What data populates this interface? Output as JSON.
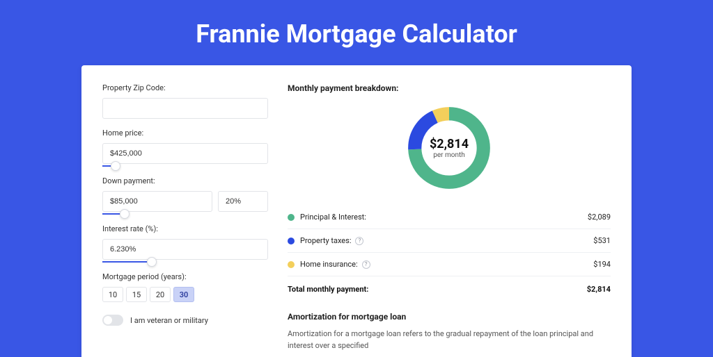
{
  "title": "Frannie Mortgage Calculator",
  "form": {
    "zip_label": "Property Zip Code:",
    "zip_value": "",
    "home_price_label": "Home price:",
    "home_price_value": "$425,000",
    "down_payment_label": "Down payment:",
    "down_payment_value": "$85,000",
    "down_payment_pct_value": "20%",
    "interest_label": "Interest rate (%):",
    "interest_value": "6.230%",
    "period_label": "Mortgage period (years):",
    "period_options": [
      "10",
      "15",
      "20",
      "30"
    ],
    "period_selected": "30",
    "veteran_label": "I am veteran or military"
  },
  "sliders": {
    "home_price_pct": 8,
    "down_payment_pct": 20,
    "interest_pct": 30
  },
  "breakdown": {
    "heading": "Monthly payment breakdown:",
    "donut_amount": "$2,814",
    "donut_sub": "per month",
    "items": [
      {
        "label": "Principal & Interest:",
        "value": "$2,089",
        "color": "#4fb58b",
        "info": false
      },
      {
        "label": "Property taxes:",
        "value": "$531",
        "color": "#2b4ae0",
        "info": true
      },
      {
        "label": "Home insurance:",
        "value": "$194",
        "color": "#f3cf5b",
        "info": true
      }
    ],
    "total_label": "Total monthly payment:",
    "total_value": "$2,814"
  },
  "amortization": {
    "heading": "Amortization for mortgage loan",
    "text": "Amortization for a mortgage loan refers to the gradual repayment of the loan principal and interest over a specified"
  },
  "chart_data": {
    "type": "pie",
    "title": "Monthly payment breakdown",
    "series": [
      {
        "name": "Principal & Interest",
        "value": 2089,
        "color": "#4fb58b"
      },
      {
        "name": "Property taxes",
        "value": 531,
        "color": "#2b4ae0"
      },
      {
        "name": "Home insurance",
        "value": 194,
        "color": "#f3cf5b"
      }
    ],
    "total": 2814,
    "unit": "USD per month"
  }
}
